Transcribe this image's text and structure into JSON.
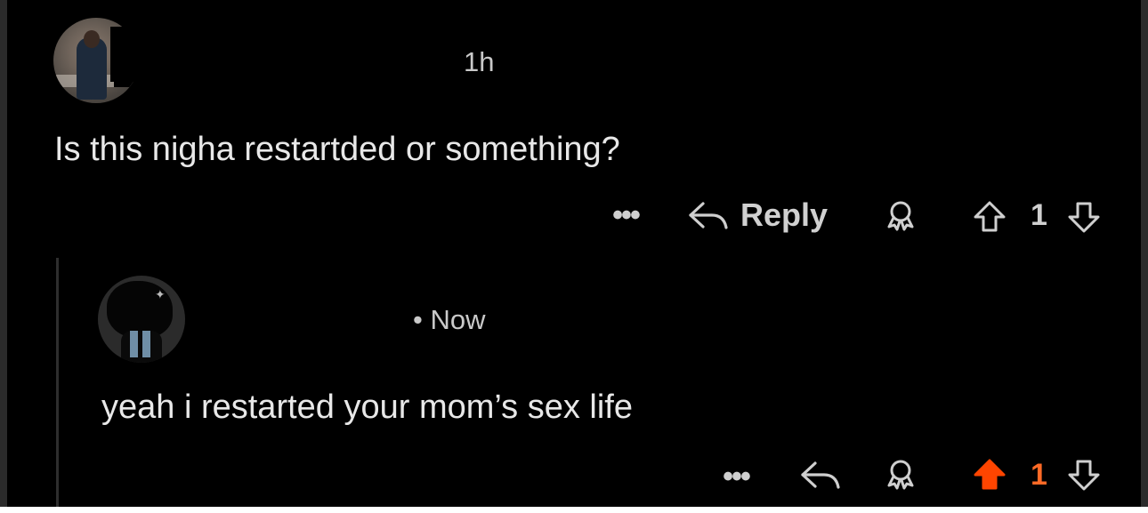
{
  "comments": [
    {
      "time": "1h",
      "text": "Is this nigha restartded or something?",
      "actions": {
        "more": "•••",
        "reply_label": "Reply",
        "vote_count": "1",
        "vote_state": "none"
      }
    },
    {
      "time": "• Now",
      "text": "yeah i restarted your mom’s sex life",
      "actions": {
        "more": "•••",
        "vote_count": "1",
        "vote_state": "upvoted"
      }
    }
  ],
  "colors": {
    "background": "#000000",
    "text": "#e8e8e8",
    "meta": "#c9c9c9",
    "upvote_active": "#ff4500",
    "count_active": "#ff6a26"
  },
  "icons": [
    "reply-arrow-icon",
    "award-icon",
    "upvote-arrow-icon",
    "downvote-arrow-icon",
    "more-dots-icon"
  ]
}
